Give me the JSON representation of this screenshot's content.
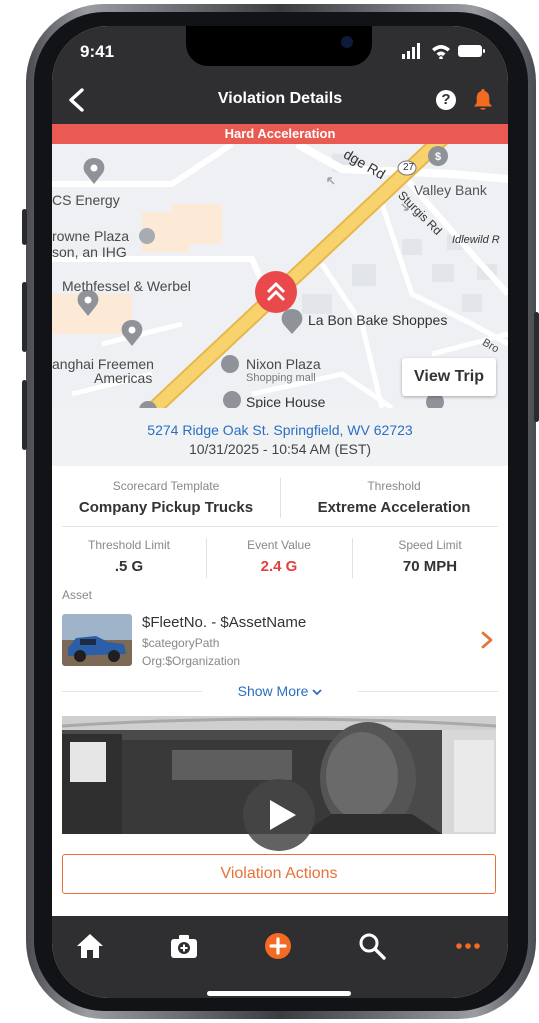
{
  "status_bar": {
    "time": "9:41"
  },
  "nav": {
    "title": "Violation Details",
    "help_label": "?"
  },
  "banner": {
    "text": "Hard Acceleration",
    "color": "#e95a52"
  },
  "map": {
    "labels": {
      "edge_rd": "dge Rd",
      "valley_bank": "Valley Bank",
      "sturgis_rd": "Sturgis Rd",
      "idlewild": "Idlewild R",
      "cs_energy": "CS Energy",
      "crowne_1": "rowne Plaza",
      "crowne_2": "son, an IHG",
      "methfessel": "Methfessel & Werbel",
      "la_bon": "La Bon Bake Shoppes",
      "shanghai_1": "anghai Freemen",
      "shanghai_2": "Americas",
      "nixon": "Nixon Plaza",
      "nixon_sub": "Shopping mall",
      "spice": "Spice House",
      "brook": "Bro",
      "route": "27"
    },
    "view_trip_label": "View Trip"
  },
  "location": {
    "address": "5274 Ridge Oak St. Springfield, WV 62723",
    "datetime": "10/31/2025 - 10:54 AM (EST)"
  },
  "scorecard": {
    "template_label": "Scorecard Template",
    "template_value": "Company Pickup Trucks",
    "threshold_label": "Threshold",
    "threshold_value": "Extreme Acceleration"
  },
  "metrics": {
    "threshold_limit_label": "Threshold Limit",
    "threshold_limit_value": ".5 G",
    "event_value_label": "Event Value",
    "event_value_value": "2.4 G",
    "speed_limit_label": "Speed Limit",
    "speed_limit_value": "70 MPH",
    "event_color": "#e0433e"
  },
  "asset": {
    "section_label": "Asset",
    "name": "$FleetNo. - $AssetName",
    "category": "$categoryPath",
    "org": "Org:$Organization"
  },
  "show_more_label": "Show More",
  "actions_label": "Violation Actions",
  "accent_color": "#e8713a",
  "tabs": [
    "home-icon",
    "camera-plus-icon",
    "add-circle-icon",
    "search-icon",
    "more-icon"
  ]
}
